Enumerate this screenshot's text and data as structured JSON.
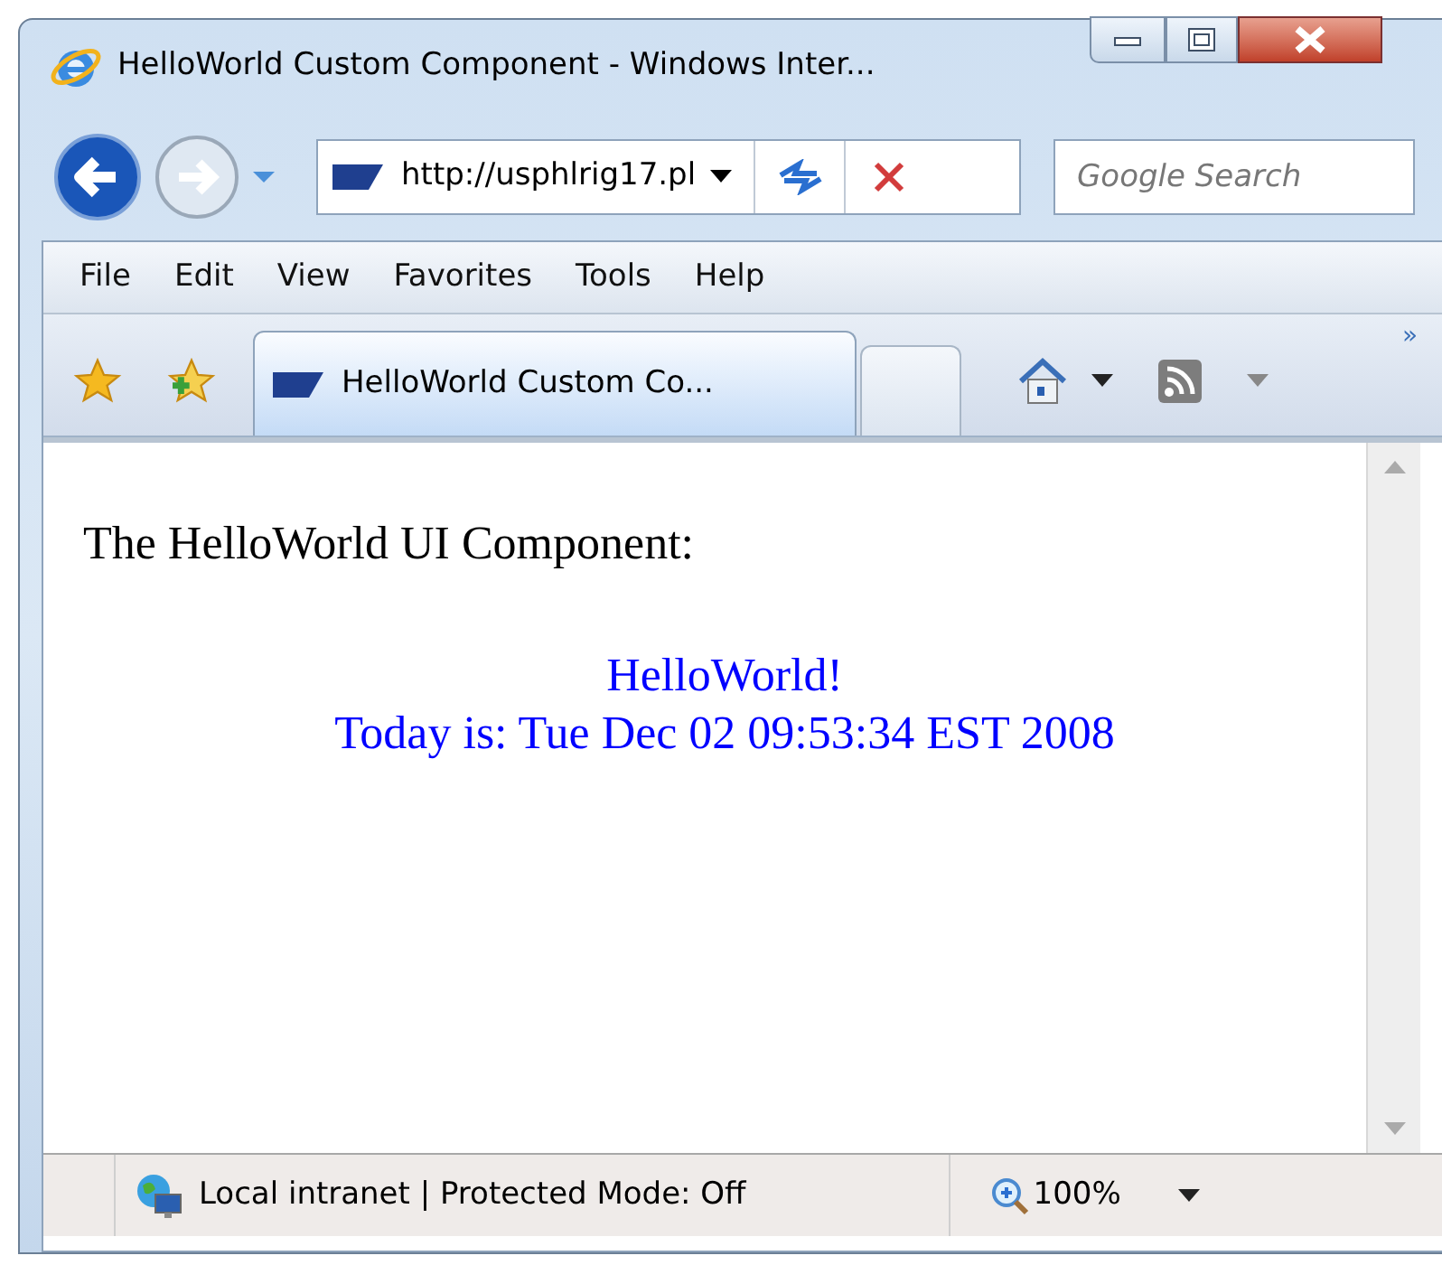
{
  "window": {
    "title": "HelloWorld Custom Component - Windows Inter..."
  },
  "address_bar": {
    "value": "http://usphlrig17.pl"
  },
  "search": {
    "placeholder": "Google Search"
  },
  "menu": [
    "File",
    "Edit",
    "View",
    "Favorites",
    "Tools",
    "Help"
  ],
  "tabs": [
    {
      "label": "HelloWorld Custom Co...",
      "selected": true
    }
  ],
  "toolbar_overflow": "»",
  "content": {
    "heading": "The HelloWorld UI Component:",
    "lines": [
      "HelloWorld!",
      "Today is: Tue Dec 02 09:53:34 EST 2008"
    ]
  },
  "status_bar": {
    "zone": "Local intranet | Protected Mode: Off",
    "zoom": "100%"
  }
}
